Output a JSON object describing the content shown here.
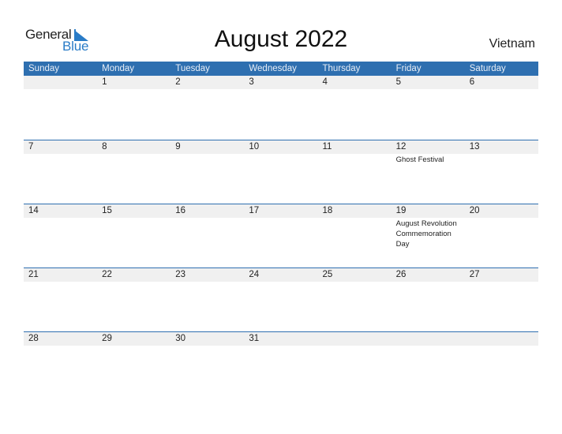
{
  "logo": {
    "word1": "General",
    "word2": "Blue",
    "accent_color": "#2a7cc7"
  },
  "title": "August 2022",
  "country": "Vietnam",
  "header_color": "#2e6fb0",
  "weekdays": [
    "Sunday",
    "Monday",
    "Tuesday",
    "Wednesday",
    "Thursday",
    "Friday",
    "Saturday"
  ],
  "weeks": [
    {
      "days": [
        "",
        "1",
        "2",
        "3",
        "4",
        "5",
        "6"
      ],
      "events": [
        "",
        "",
        "",
        "",
        "",
        "",
        ""
      ]
    },
    {
      "days": [
        "7",
        "8",
        "9",
        "10",
        "11",
        "12",
        "13"
      ],
      "events": [
        "",
        "",
        "",
        "",
        "",
        "Ghost Festival",
        ""
      ]
    },
    {
      "days": [
        "14",
        "15",
        "16",
        "17",
        "18",
        "19",
        "20"
      ],
      "events": [
        "",
        "",
        "",
        "",
        "",
        "August Revolution Commemoration Day",
        ""
      ]
    },
    {
      "days": [
        "21",
        "22",
        "23",
        "24",
        "25",
        "26",
        "27"
      ],
      "events": [
        "",
        "",
        "",
        "",
        "",
        "",
        ""
      ]
    },
    {
      "days": [
        "28",
        "29",
        "30",
        "31",
        "",
        "",
        ""
      ],
      "events": [
        "",
        "",
        "",
        "",
        "",
        "",
        ""
      ]
    }
  ]
}
